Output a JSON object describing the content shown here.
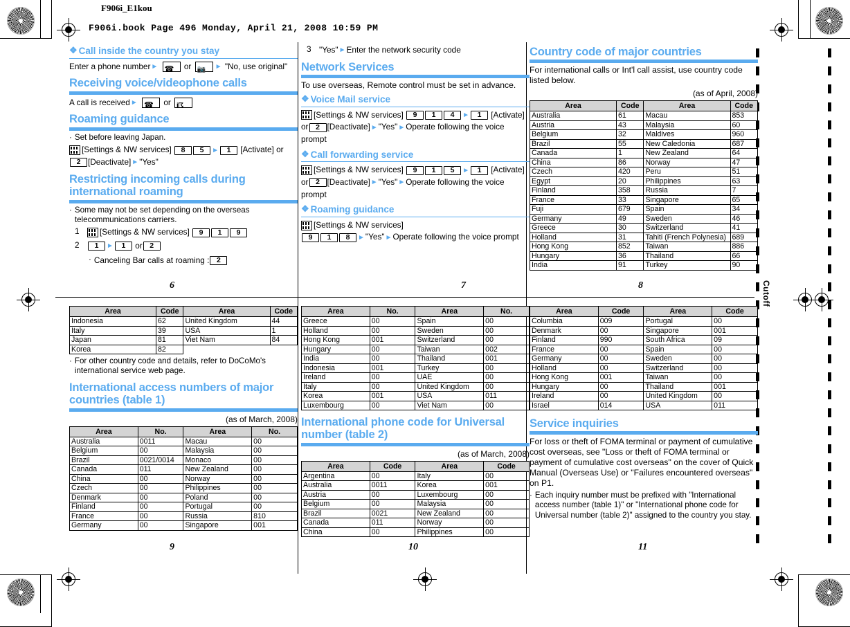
{
  "header": {
    "doc_title": "F906i_E1kou",
    "book_line": "F906i.book  Page 496  Monday, April 21, 2008  10:59 PM",
    "cutoff_label": "Cutoff"
  },
  "page6": {
    "number": "6",
    "h2_call_inside": "Call inside the country you stay",
    "call_inside_steps": {
      "prefix": "Enter a phone number",
      "or": "or",
      "suffix": "\"No, use original\""
    },
    "h1_receiving": "Receiving voice/videophone calls",
    "receiving_steps": {
      "prefix": "A call is received",
      "or": "or"
    },
    "h1_roaming": "Roaming guidance",
    "roaming_bullet": "Set before leaving Japan.",
    "roaming_line1_label": "[Settings & NW services]",
    "roaming_keys": [
      "8",
      "5"
    ],
    "roaming_key_activate": "1",
    "roaming_activate_label": "[Activate]",
    "roaming_or": "or",
    "roaming_key_deactivate": "2",
    "roaming_deactivate_label": "[Deactivate]",
    "roaming_yes": "\"Yes\"",
    "h1_restricting": "Restricting incoming calls during international roaming",
    "restricting_bullet": "Some may not be set depending on the overseas telecommunications carriers.",
    "step1_num": "1",
    "step1_label": "[Settings & NW services]",
    "step1_keys": [
      "9",
      "1",
      "9"
    ],
    "step2_num": "2",
    "step2_keys_a": "1",
    "step2_keys_b": "1",
    "step2_or": "or",
    "step2_keys_c": "2",
    "step2_sub": "Canceling Bar calls at roaming :",
    "step2_sub_key": "2"
  },
  "page7": {
    "number": "7",
    "step3_num": "3",
    "step3_text_a": "\"Yes\"",
    "step3_text_b": "Enter the network security code",
    "h1_network_services": "Network Services",
    "network_intro": "To use overseas, Remote control must be set in advance.",
    "h2_voice_mail": "Voice Mail service",
    "voice_mail_label": "[Settings & NW services]",
    "voice_mail_keys": [
      "9",
      "1",
      "4"
    ],
    "voice_mail_key_activate": "1",
    "activate_label": "[Activate]",
    "or": "or",
    "key_deactivate": "2",
    "deactivate_label": "[Deactivate]",
    "yes": "\"Yes\"",
    "operate_text": "Operate following the voice prompt",
    "h2_call_forwarding": "Call forwarding service",
    "call_fwd_label": "[Settings & NW services]",
    "call_fwd_keys": [
      "9",
      "1",
      "5"
    ],
    "call_fwd_key_activate": "1",
    "h2_roaming_guidance": "Roaming guidance",
    "roam_label": "[Settings & NW services]",
    "roam_keys": [
      "9",
      "1",
      "8"
    ],
    "roam_yes": "\"Yes\"",
    "roam_operate": "Operate following the voice prompt"
  },
  "page8": {
    "number": "8",
    "h1": "Country code of major countries",
    "intro": "For international calls or Int'l call assist, use country code listed below.",
    "asof": "(as of April, 2008)",
    "headers": [
      "Area",
      "Code",
      "Area",
      "Code"
    ],
    "rows": [
      [
        "Australia",
        "61",
        "Macau",
        "853"
      ],
      [
        "Austria",
        "43",
        "Malaysia",
        "60"
      ],
      [
        "Belgium",
        "32",
        "Maldives",
        "960"
      ],
      [
        "Brazil",
        "55",
        "New Caledonia",
        "687"
      ],
      [
        "Canada",
        "1",
        "New Zealand",
        "64"
      ],
      [
        "China",
        "86",
        "Norway",
        "47"
      ],
      [
        "Czech",
        "420",
        "Peru",
        "51"
      ],
      [
        "Egypt",
        "20",
        "Philippines",
        "63"
      ],
      [
        "Finland",
        "358",
        "Russia",
        "7"
      ],
      [
        "France",
        "33",
        "Singapore",
        "65"
      ],
      [
        "Fuji",
        "679",
        "Spain",
        "34"
      ],
      [
        "Germany",
        "49",
        "Sweden",
        "46"
      ],
      [
        "Greece",
        "30",
        "Switzerland",
        "41"
      ],
      [
        "Holland",
        "31",
        "Tahiti (French Polynesia)",
        "689"
      ],
      [
        "Hong Kong",
        "852",
        "Taiwan",
        "886"
      ],
      [
        "Hungary",
        "36",
        "Thailand",
        "66"
      ],
      [
        "India",
        "91",
        "Turkey",
        "90"
      ]
    ]
  },
  "page9": {
    "number": "9",
    "headers": [
      "Area",
      "Code",
      "Area",
      "Code"
    ],
    "rows": [
      [
        "Indonesia",
        "62",
        "United Kingdom",
        "44"
      ],
      [
        "Italy",
        "39",
        "USA",
        "1"
      ],
      [
        "Japan",
        "81",
        "Viet Nam",
        "84"
      ],
      [
        "Korea",
        "82",
        "",
        ""
      ]
    ],
    "bullet": "For other country code and details, refer to DoCoMo's international service web page.",
    "h1": "International access numbers of major countries (table 1)",
    "asof": "(as of March, 2008)",
    "headers2": [
      "Area",
      "No.",
      "Area",
      "No."
    ],
    "rows2": [
      [
        "Australia",
        "0011",
        "Macau",
        "00"
      ],
      [
        "Belgium",
        "00",
        "Malaysia",
        "00"
      ],
      [
        "Brazil",
        "0021/0014",
        "Monaco",
        "00"
      ],
      [
        "Canada",
        "011",
        "New Zealand",
        "00"
      ],
      [
        "China",
        "00",
        "Norway",
        "00"
      ],
      [
        "Czech",
        "00",
        "Philippines",
        "00"
      ],
      [
        "Denmark",
        "00",
        "Poland",
        "00"
      ],
      [
        "Finland",
        "00",
        "Portugal",
        "00"
      ],
      [
        "France",
        "00",
        "Russia",
        "810"
      ],
      [
        "Germany",
        "00",
        "Singapore",
        "001"
      ]
    ]
  },
  "page10": {
    "number": "10",
    "headers": [
      "Area",
      "No.",
      "Area",
      "No."
    ],
    "rows": [
      [
        "Greece",
        "00",
        "Spain",
        "00"
      ],
      [
        "Holland",
        "00",
        "Sweden",
        "00"
      ],
      [
        "Hong Kong",
        "001",
        "Switzerland",
        "00"
      ],
      [
        "Hungary",
        "00",
        "Taiwan",
        "002"
      ],
      [
        "India",
        "00",
        "Thailand",
        "001"
      ],
      [
        "Indonesia",
        "001",
        "Turkey",
        "00"
      ],
      [
        "Ireland",
        "00",
        "UAE",
        "00"
      ],
      [
        "Italy",
        "00",
        "United Kingdom",
        "00"
      ],
      [
        "Korea",
        "001",
        "USA",
        "011"
      ],
      [
        "Luxembourg",
        "00",
        "Viet Nam",
        "00"
      ]
    ],
    "h1": "International phone code for Universal number (table 2)",
    "asof": "(as of March, 2008)",
    "headers2": [
      "Area",
      "Code",
      "Area",
      "Code"
    ],
    "rows2": [
      [
        "Argentina",
        "00",
        "Italy",
        "00"
      ],
      [
        "Australia",
        "0011",
        "Korea",
        "001"
      ],
      [
        "Austria",
        "00",
        "Luxembourg",
        "00"
      ],
      [
        "Belgium",
        "00",
        "Malaysia",
        "00"
      ],
      [
        "Brazil",
        "0021",
        "New Zealand",
        "00"
      ],
      [
        "Canada",
        "011",
        "Norway",
        "00"
      ],
      [
        "China",
        "00",
        "Philippines",
        "00"
      ]
    ]
  },
  "page11": {
    "number": "11",
    "headers": [
      "Area",
      "Code",
      "Area",
      "Code"
    ],
    "rows": [
      [
        "Columbia",
        "009",
        "Portugal",
        "00"
      ],
      [
        "Denmark",
        "00",
        "Singapore",
        "001"
      ],
      [
        "Finland",
        "990",
        "South Africa",
        "09"
      ],
      [
        "France",
        "00",
        "Spain",
        "00"
      ],
      [
        "Germany",
        "00",
        "Sweden",
        "00"
      ],
      [
        "Holland",
        "00",
        "Switzerland",
        "00"
      ],
      [
        "Hong Kong",
        "001",
        "Taiwan",
        "00"
      ],
      [
        "Hungary",
        "00",
        "Thailand",
        "001"
      ],
      [
        "Ireland",
        "00",
        "United Kingdom",
        "00"
      ],
      [
        "Israel",
        "014",
        "USA",
        "011"
      ]
    ],
    "h1": "Service inquiries",
    "body": "For loss or theft of FOMA terminal or payment of cumulative cost overseas, see \"Loss or theft of FOMA terminal or payment of cumulative cost overseas\" on the cover of Quick Manual (Overseas Use) or \"Failures encountered overseas\" on P1.",
    "bullet": "Each inquiry number must be prefixed with \"International access number (table 1)\" or \"International phone code for Universal number (table 2)\" assigned to the country you stay."
  },
  "colors": {
    "accent": "#5aabef",
    "table_header": "#d4d4d4",
    "rule": "#000000"
  }
}
